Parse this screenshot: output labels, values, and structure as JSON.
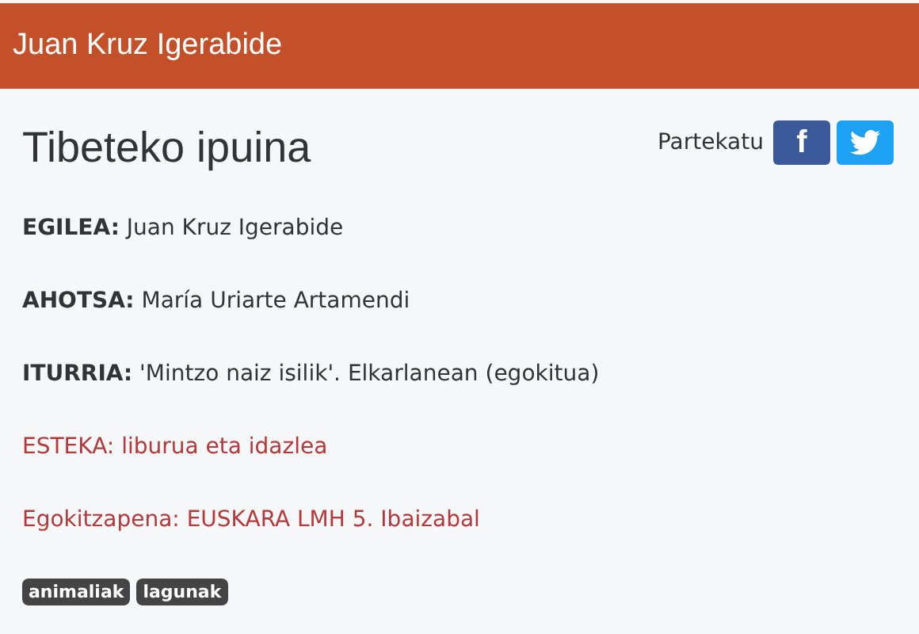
{
  "header": {
    "title": "Juan Kruz Igerabide"
  },
  "article": {
    "title": "Tibeteko ipuina",
    "share": {
      "label": "Partekatu",
      "buttons": [
        {
          "kind": "facebook",
          "glyph": "f"
        },
        {
          "kind": "twitter"
        }
      ]
    },
    "fields": [
      {
        "kind": "info",
        "label": "EGILEA:",
        "value": "Juan Kruz Igerabide"
      },
      {
        "kind": "info",
        "label": "AHOTSA:",
        "value": "María Uriarte Artamendi"
      },
      {
        "kind": "info",
        "label": "ITURRIA:",
        "value": "'Mintzo naiz isilik'. Elkarlanean (egokitua)"
      },
      {
        "kind": "link",
        "text": "ESTEKA: liburua eta idazlea"
      },
      {
        "kind": "link",
        "text": "Egokitzapena: EUSKARA LMH 5. Ibaizabal"
      }
    ],
    "tags": [
      "animaliak",
      "lagunak"
    ]
  }
}
